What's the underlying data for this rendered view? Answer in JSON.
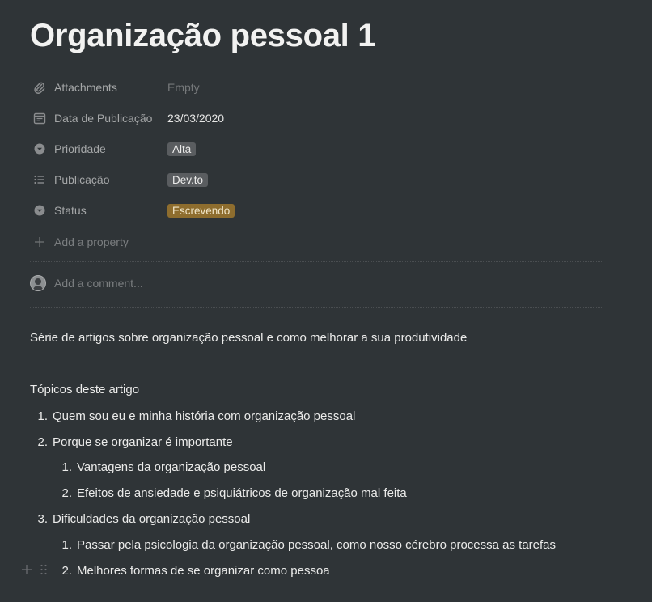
{
  "page": {
    "title": "Organização pessoal 1"
  },
  "properties": [
    {
      "icon": "paperclip-icon",
      "name": "Attachments",
      "value": "Empty",
      "kind": "empty"
    },
    {
      "icon": "calendar-icon",
      "name": "Data de Publicação",
      "value": "23/03/2020",
      "kind": "text"
    },
    {
      "icon": "select-icon",
      "name": "Prioridade",
      "value": "Alta",
      "kind": "tag"
    },
    {
      "icon": "list-icon",
      "name": "Publicação",
      "value": "Dev.to",
      "kind": "tag"
    },
    {
      "icon": "select-icon",
      "name": "Status",
      "value": "Escrevendo",
      "kind": "tag-status"
    }
  ],
  "add_property_label": "Add a property",
  "comment": {
    "placeholder": "Add a comment..."
  },
  "content": {
    "intro": "Série de artigos sobre organização pessoal e como melhorar a sua produtividade",
    "topics_heading": "Tópicos deste artigo",
    "list": [
      {
        "num": "1.",
        "text": "Quem sou eu e minha história com organização pessoal",
        "level": 1
      },
      {
        "num": "2.",
        "text": "Porque se organizar é importante",
        "level": 1
      },
      {
        "num": "1.",
        "text": "Vantagens da organização pessoal",
        "level": 2
      },
      {
        "num": "2.",
        "text": "Efeitos de ansiedade e psiquiátricos de organização mal feita",
        "level": 2
      },
      {
        "num": "3.",
        "text": "Dificuldades da organização pessoal",
        "level": 1
      },
      {
        "num": "1.",
        "text": "Passar pela psicologia da organização pessoal, como nosso cérebro processa as tarefas",
        "level": 2
      },
      {
        "num": "2.",
        "text": "Melhores formas de se organizar como pessoa",
        "level": 2
      }
    ]
  },
  "colors": {
    "background": "#2f3437",
    "tag": "#5a5d60",
    "status_tag": "#8e6d2e"
  }
}
